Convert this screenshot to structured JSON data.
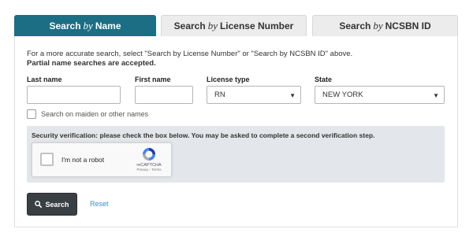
{
  "tabs": [
    {
      "pre": "Search",
      "by": "by",
      "post": "Name",
      "active": true
    },
    {
      "pre": "Search",
      "by": "by",
      "post": "License Number",
      "active": false
    },
    {
      "pre": "Search",
      "by": "by",
      "post": "NCSBN ID",
      "active": false
    }
  ],
  "intro": {
    "line1": "For a more accurate search, select \"Search by License Number\" or \"Search by NCSBN ID\" above.",
    "line2": "Partial name searches are accepted."
  },
  "form": {
    "last_name_label": "Last name",
    "last_name_value": "",
    "first_name_label": "First name",
    "first_name_value": "",
    "license_type_label": "License type",
    "license_type_value": "RN",
    "state_label": "State",
    "state_value": "NEW YORK",
    "maiden_label": "Search on maiden or other names"
  },
  "security": {
    "text": "Security verification: please check the box below. You may be asked to complete a second verification step.",
    "robot_label": "I'm not a robot",
    "brand": "reCAPTCHA",
    "privacy": "Privacy - Terms"
  },
  "actions": {
    "search_label": "Search",
    "reset_label": "Reset"
  },
  "colors": {
    "active_tab": "#1b6e84",
    "search_button": "#3a3f44",
    "reset_link": "#3a8ec5"
  }
}
